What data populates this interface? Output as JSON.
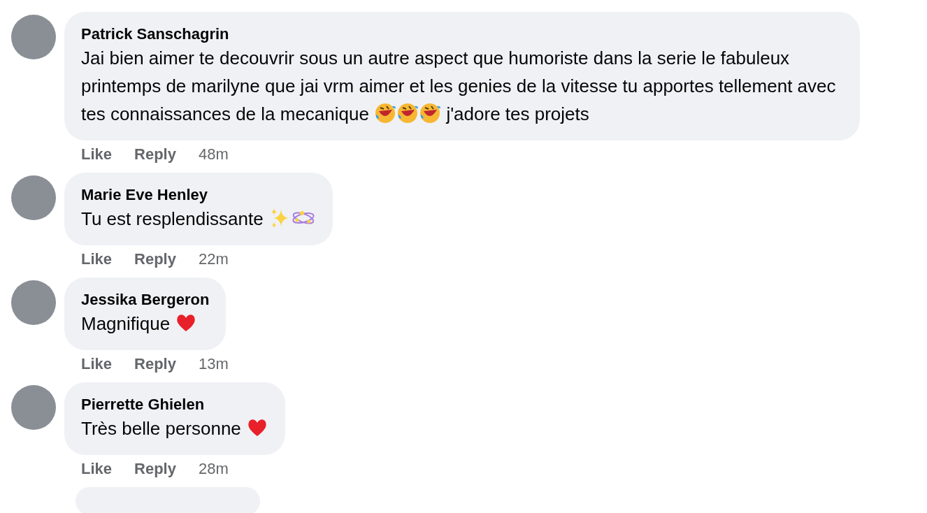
{
  "comments": [
    {
      "author": "Patrick Sanschagrin",
      "body": [
        {
          "kind": "text",
          "text": "Jai bien aimer te decouvrir sous un autre aspect que humoriste dans la serie le fabuleux printemps de marilyne que jai vrm aimer et les genies de la vitesse tu apportes tellement avec tes connaissances de la mecanique "
        },
        {
          "kind": "rofl"
        },
        {
          "kind": "rofl"
        },
        {
          "kind": "rofl"
        },
        {
          "kind": "text",
          "text": " j'adore tes projets"
        }
      ],
      "actions": [
        "Like",
        "Reply"
      ],
      "time": "48m"
    },
    {
      "author": "Marie Eve Henley",
      "body": [
        {
          "kind": "text",
          "text": "Tu est resplendissante "
        },
        {
          "kind": "sparkles"
        },
        {
          "kind": "orbit"
        }
      ],
      "actions": [
        "Like",
        "Reply"
      ],
      "time": "22m"
    },
    {
      "author": "Jessika Bergeron",
      "body": [
        {
          "kind": "text",
          "text": "Magnifique "
        },
        {
          "kind": "heart"
        }
      ],
      "actions": [
        "Like",
        "Reply"
      ],
      "time": "13m"
    },
    {
      "author": "Pierrette Ghielen",
      "body": [
        {
          "kind": "text",
          "text": "Très belle personne "
        },
        {
          "kind": "heart"
        }
      ],
      "actions": [
        "Like",
        "Reply"
      ],
      "time": "28m"
    }
  ]
}
